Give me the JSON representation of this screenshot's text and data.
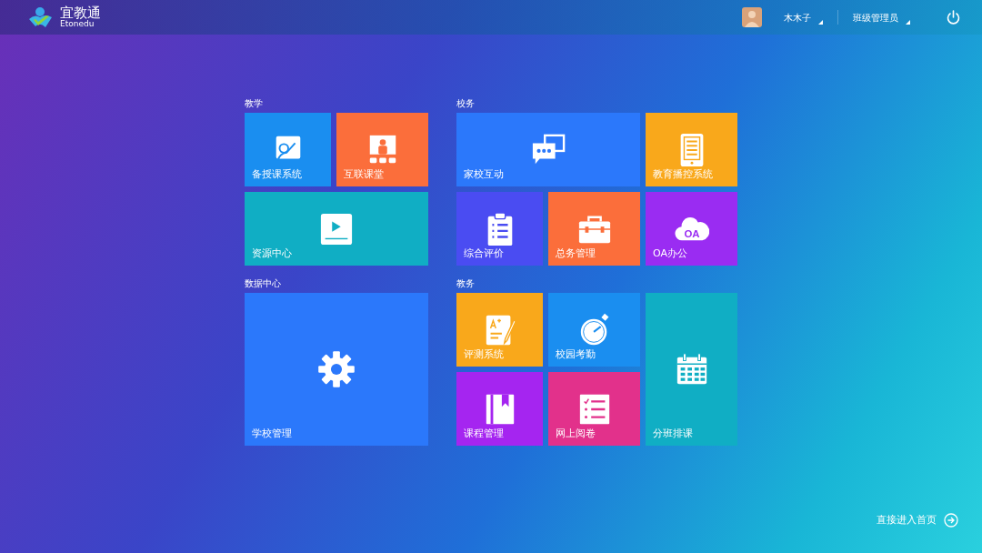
{
  "header": {
    "logo_title": "宜教通",
    "logo_subtitle": "Etonedu",
    "user_name": "木木子",
    "role": "班级管理员"
  },
  "columns": [
    {
      "groups": [
        {
          "title": "教学",
          "tiles": [
            {
              "label": "备授课系统",
              "kind": "board",
              "color": "#1a8ef0"
            },
            {
              "label": "互联课堂",
              "kind": "classroom",
              "color": "#fb6e3b"
            },
            {
              "label": "资源中心",
              "kind": "video",
              "color": "#10aec4"
            }
          ]
        },
        {
          "title": "数据中心",
          "tiles": [
            {
              "label": "学校管理",
              "kind": "gear",
              "color": "#2b78fb"
            }
          ]
        }
      ]
    },
    {
      "groups": [
        {
          "title": "校务",
          "tiles": [
            {
              "label": "家校互动",
              "kind": "chat",
              "color": "#2b78fb"
            },
            {
              "label": "教育播控系统",
              "kind": "tablet",
              "color": "#f9a81b"
            },
            {
              "label": "综合评价",
              "kind": "clipboard",
              "color": "#4a4cf2"
            },
            {
              "label": "总务管理",
              "kind": "toolbox",
              "color": "#fb6e3b"
            },
            {
              "label": "OA办公",
              "kind": "cloud",
              "icon_text": "OA",
              "color": "#9a2cf2"
            }
          ]
        },
        {
          "title": "教务",
          "tiles": [
            {
              "label": "评测系统",
              "kind": "grade",
              "color": "#f9a81b"
            },
            {
              "label": "校园考勤",
              "kind": "stopwatch",
              "color": "#1a8ef0"
            },
            {
              "label": "课程管理",
              "kind": "book",
              "color": "#a525f0"
            },
            {
              "label": "网上阅卷",
              "kind": "checklist",
              "color": "#e2318b"
            },
            {
              "label": "分班排课",
              "kind": "calendar",
              "color": "#10aec4"
            }
          ]
        }
      ]
    }
  ],
  "footer": {
    "link": "直接进入首页"
  }
}
